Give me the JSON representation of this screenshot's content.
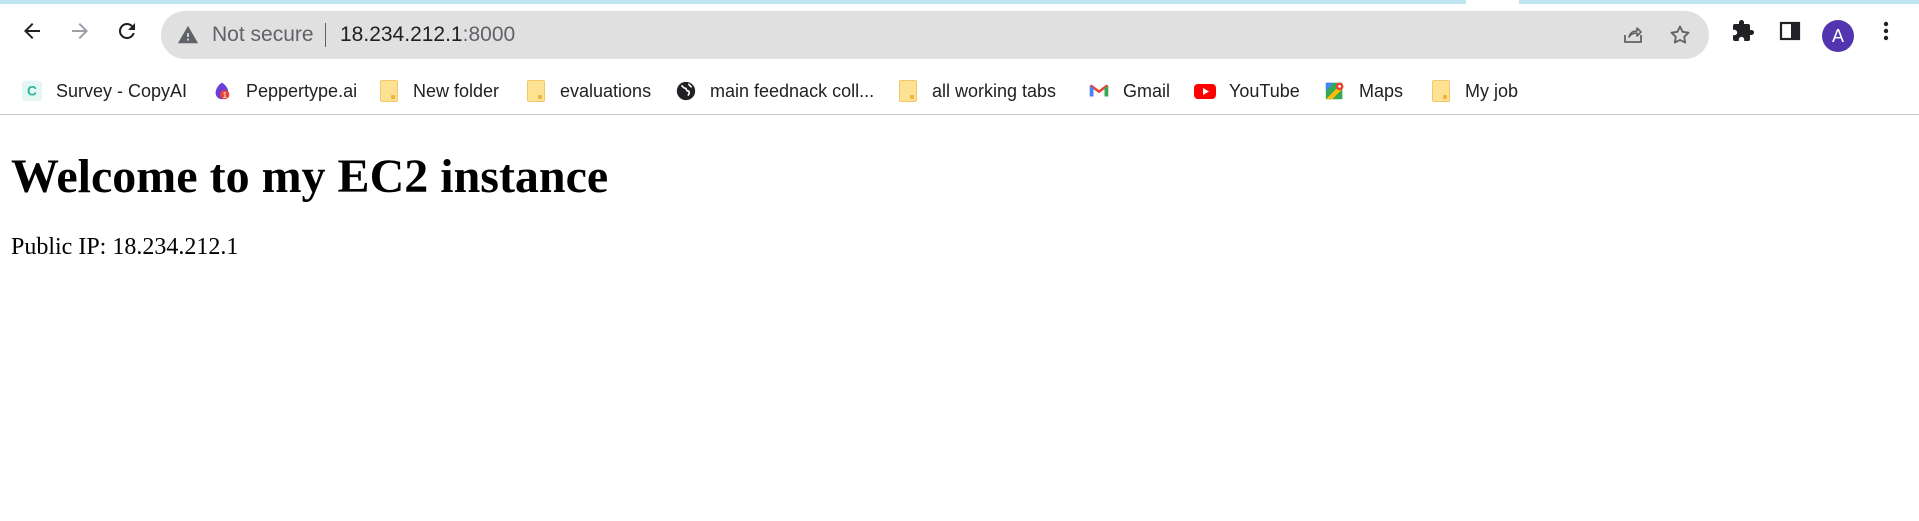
{
  "browser": {
    "security_label": "Not secure",
    "url_host": "18.234.212.1",
    "url_port": ":8000",
    "profile_initial": "A",
    "colors": {
      "avatar": "#5335b0",
      "omnibox": "#e0e0e0",
      "accent_strip": "#bfe6f2"
    }
  },
  "bookmarks": [
    {
      "label": "Survey - CopyAI",
      "icon": "copyai-icon"
    },
    {
      "label": "Peppertype.ai",
      "icon": "peppertype-icon"
    },
    {
      "label": "New folder",
      "icon": "folder-icon"
    },
    {
      "label": "evaluations",
      "icon": "folder-icon"
    },
    {
      "label": "main feednack coll...",
      "icon": "globe-icon"
    },
    {
      "label": "all working tabs",
      "icon": "folder-icon"
    },
    {
      "label": "Gmail",
      "icon": "gmail-icon"
    },
    {
      "label": "YouTube",
      "icon": "youtube-icon"
    },
    {
      "label": "Maps",
      "icon": "maps-icon"
    },
    {
      "label": "My job",
      "icon": "folder-icon"
    }
  ],
  "page": {
    "heading": "Welcome to my EC2 instance",
    "public_ip_text": "Public IP: 18.234.212.1"
  }
}
